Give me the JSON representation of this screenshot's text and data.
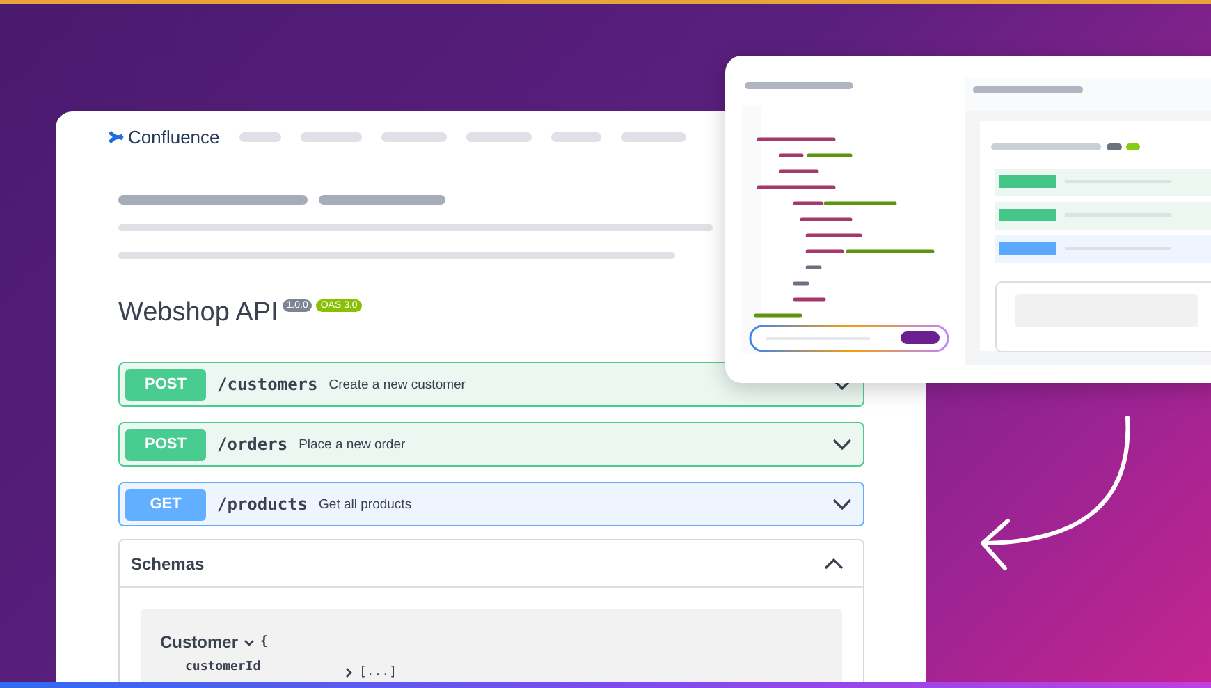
{
  "header": {
    "product": "Confluence"
  },
  "api": {
    "title": "Webshop API",
    "badges": [
      {
        "label": "1.0.0",
        "kind": "version"
      },
      {
        "label": "OAS 3.0",
        "kind": "spec"
      }
    ]
  },
  "endpoints": [
    {
      "method": "POST",
      "kind": "post",
      "path": "/customers",
      "summary": "Create a new customer",
      "expanded": false
    },
    {
      "method": "POST",
      "kind": "post",
      "path": "/orders",
      "summary": "Place a new order",
      "expanded": false
    },
    {
      "method": "GET",
      "kind": "get",
      "path": "/products",
      "summary": "Get all products",
      "expanded": false
    }
  ],
  "schemas": {
    "title": "Schemas",
    "expanded": true,
    "model": {
      "name": "Customer",
      "brace": "{",
      "fields": [
        {
          "name": "customerId",
          "value": "[...]"
        }
      ]
    }
  }
}
